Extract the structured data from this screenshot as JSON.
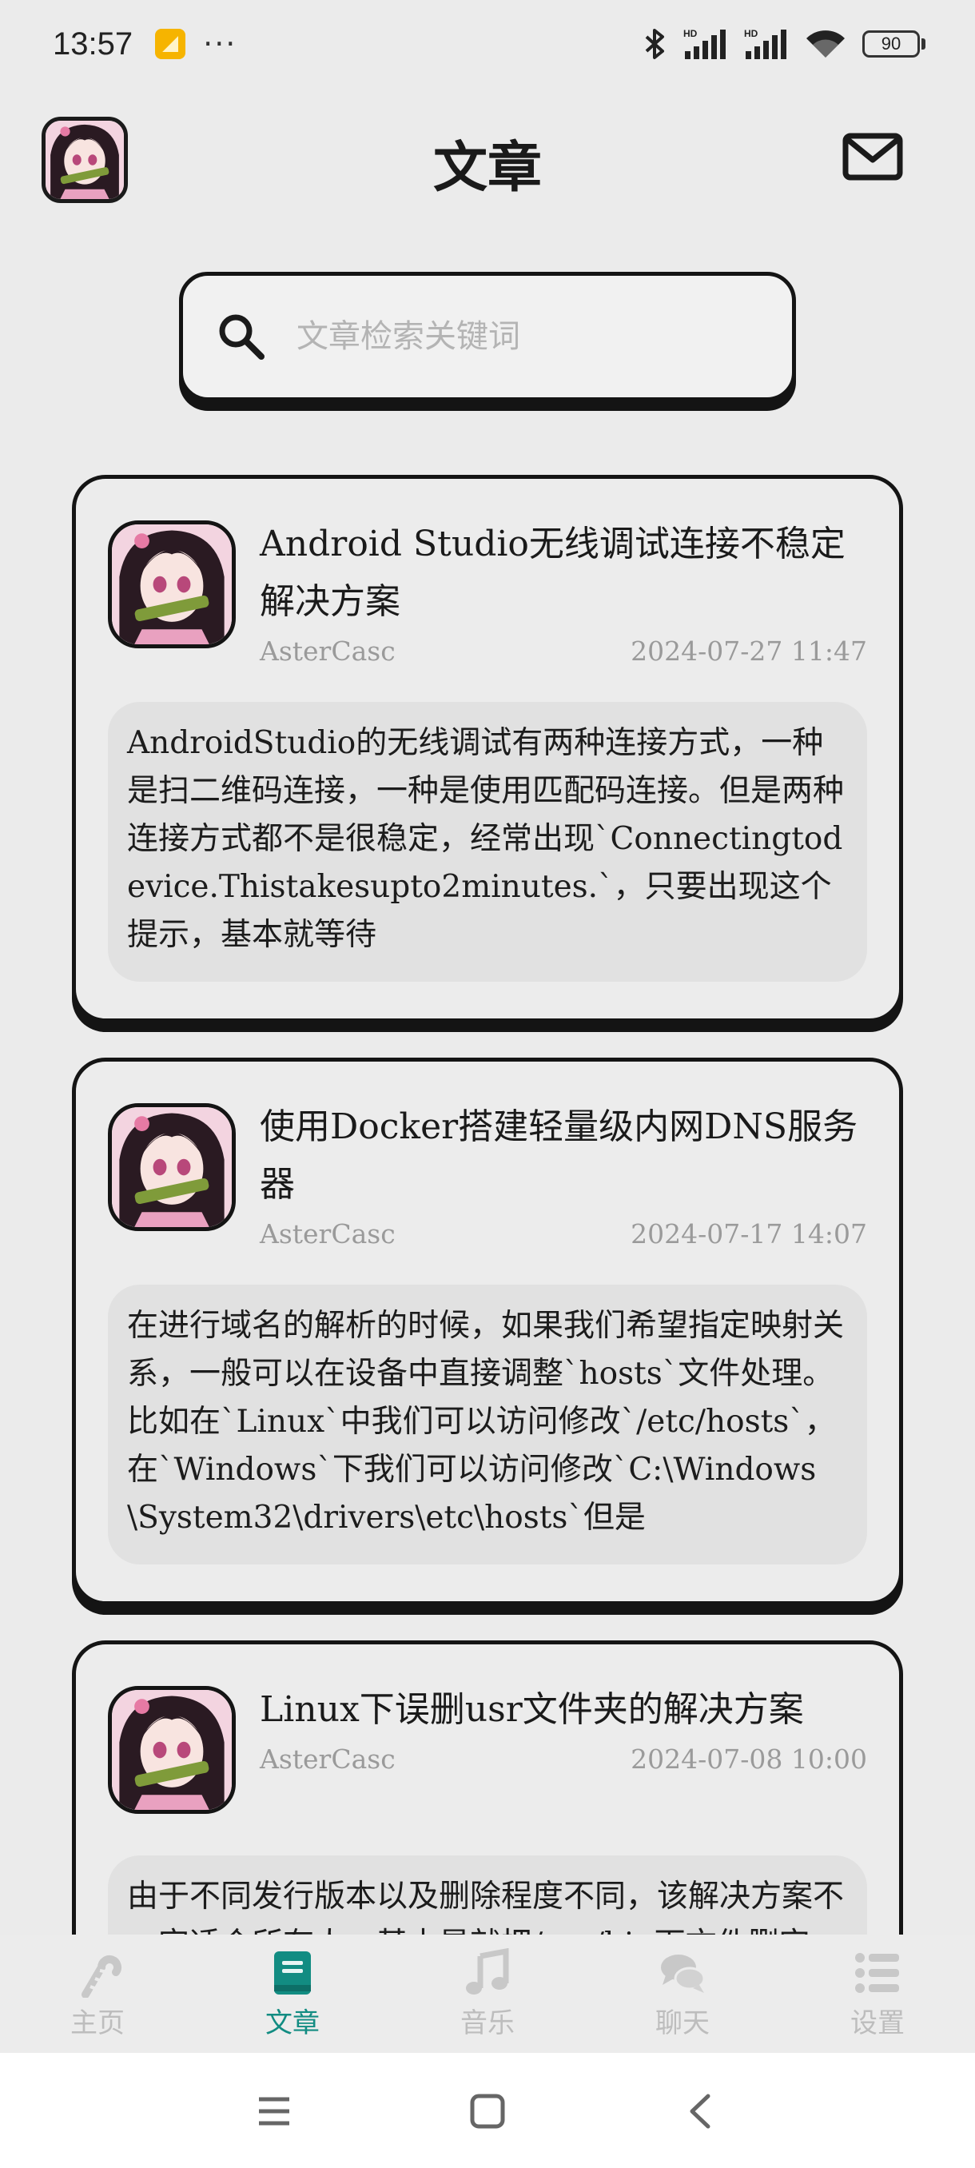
{
  "status_bar": {
    "time": "13:57",
    "more": "···",
    "battery": "90",
    "icons": [
      "notification-app-icon",
      "bluetooth-icon",
      "hd-signal-icon",
      "hd-signal-icon",
      "wifi-icon",
      "battery-icon"
    ]
  },
  "header": {
    "title": "文章",
    "avatar_icon": "anime-avatar",
    "mail_icon": "mail-icon"
  },
  "search": {
    "placeholder": "文章检索关键词",
    "value": ""
  },
  "articles": [
    {
      "title": "Android Studio无线调试连接不稳定解决方案",
      "author": "AsterCasc",
      "date": "2024-07-27 11:47",
      "summary": "AndroidStudio的无线调试有两种连接方式，一种是扫二维码连接，一种是使用匹配码连接。但是两种连接方式都不是很稳定，经常出现`Connectingtodevice.Thistakesupto2minutes.`，只要出现这个提示，基本就等待"
    },
    {
      "title": "使用Docker搭建轻量级内网DNS服务器",
      "author": "AsterCasc",
      "date": "2024-07-17 14:07",
      "summary": "在进行域名的解析的时候，如果我们希望指定映射关系，一般可以在设备中直接调整`hosts`文件处理。比如在`Linux`中我们可以访问修改`/etc/hosts`，在`Windows`下我们可以访问修改`C:\\Windows\\System32\\drivers\\etc\\hosts`但是"
    },
    {
      "title": "Linux下误删usr文件夹的解决方案",
      "author": "AsterCasc",
      "date": "2024-07-08 10:00",
      "summary": "由于不同发行版本以及删除程度不同，该解决方案不一定适合所有人，基本是就把/usr/bin下文件删完了，但是一些基础库还在，可以参考本文"
    }
  ],
  "bottom_nav": {
    "items": [
      {
        "label": "主页",
        "icon": "candy-cane-icon",
        "active": false
      },
      {
        "label": "文章",
        "icon": "book-icon",
        "active": true
      },
      {
        "label": "音乐",
        "icon": "music-note-icon",
        "active": false
      },
      {
        "label": "聊天",
        "icon": "chat-bubbles-icon",
        "active": false
      },
      {
        "label": "设置",
        "icon": "list-icon",
        "active": false
      }
    ]
  },
  "colors": {
    "accent": "#128c82",
    "inactive": "#bdbdbd",
    "border": "#141414",
    "background": "#ebebeb"
  }
}
